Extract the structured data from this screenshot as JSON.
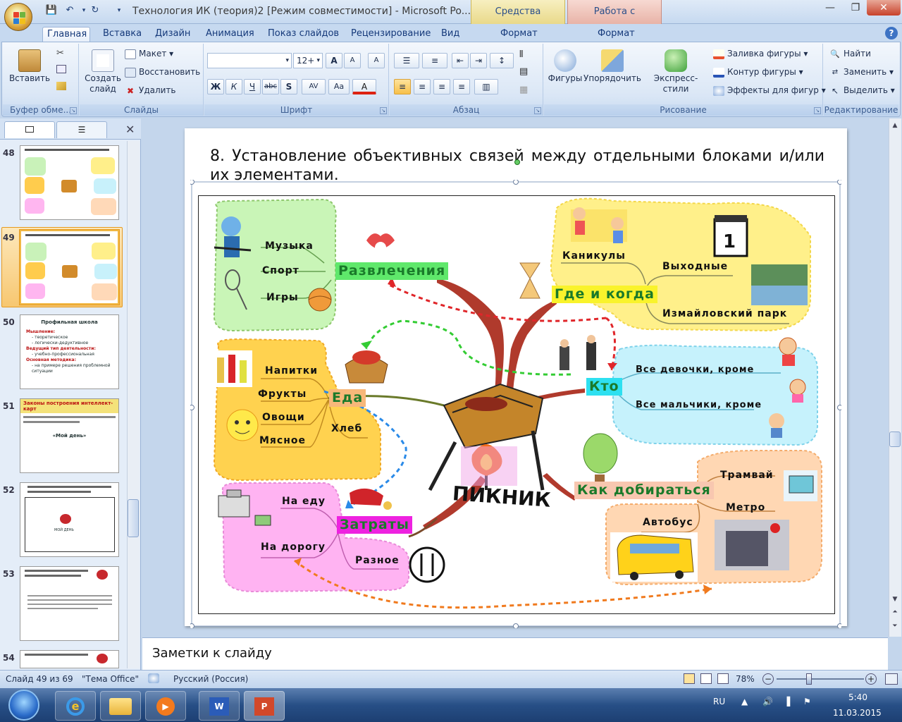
{
  "window": {
    "title": "Технология ИК (теория)2 [Режим совместимости]  -  Microsoft Po...",
    "context_tabs": [
      "Средства рисования",
      "Работа с рисунками"
    ]
  },
  "tabs": [
    "Главная",
    "Вставка",
    "Дизайн",
    "Анимация",
    "Показ слайдов",
    "Рецензирование",
    "Вид",
    "Формат",
    "Формат"
  ],
  "ribbon": {
    "clipboard": {
      "paste": "Вставить",
      "label": "Буфер обме..."
    },
    "slides": {
      "create_line1": "Создать",
      "create_line2": "слайд",
      "layout": "Макет",
      "reset": "Восстановить",
      "delete": "Удалить",
      "label": "Слайды"
    },
    "font": {
      "size": "12+",
      "bold": "Ж",
      "italic": "К",
      "underline": "Ч",
      "strike": "abc",
      "shadow": "S",
      "spacing": "AV",
      "case": "Aa",
      "color": "A",
      "grow": "A",
      "shrink": "A",
      "clear": "A",
      "label": "Шрифт"
    },
    "paragraph": {
      "label": "Абзац"
    },
    "drawing": {
      "shapes": "Фигуры",
      "arrange": "Упорядочить",
      "quick_styles": "Экспресс-стили",
      "fill": "Заливка фигуры",
      "outline": "Контур фигуры",
      "effects": "Эффекты для фигур",
      "label": "Рисование"
    },
    "editing": {
      "find": "Найти",
      "replace": "Заменить",
      "select": "Выделить",
      "label": "Редактирование"
    }
  },
  "thumbnails": [
    {
      "num": "48",
      "title": ""
    },
    {
      "num": "49",
      "title": ""
    },
    {
      "num": "50",
      "title": "Профильная школа",
      "lines": [
        "Мышление:",
        "- теоретическое",
        "- логически-дедуктивное",
        "Ведущий тип деятельности:",
        "- учебно-профессиональная",
        "Основная методика:",
        "- на примере решения проблемной ситуации"
      ]
    },
    {
      "num": "51",
      "title": "Законы построения интеллект-карт",
      "sub": "«Мой день»"
    },
    {
      "num": "52",
      "title": "",
      "sub": "МОЙ ДЕНЬ"
    },
    {
      "num": "53",
      "title": ""
    },
    {
      "num": "54",
      "title": ""
    }
  ],
  "slide": {
    "title": "8. Установление объективных связей между отдельными блоками и/или их элементами.",
    "center": "ПИКНИК",
    "branches": {
      "entertainment": {
        "title": "Развлечения",
        "items": [
          "Музыка",
          "Спорт",
          "Игры"
        ]
      },
      "where_when": {
        "title": "Где и когда",
        "items": [
          "Каникулы",
          "Выходные",
          "Измайловский парк"
        ]
      },
      "who": {
        "title": "Кто",
        "items": [
          "Все девочки, кроме",
          "Все мальчики, кроме"
        ]
      },
      "food": {
        "title": "Еда",
        "items": [
          "Напитки",
          "Фрукты",
          "Овощи",
          "Мясное",
          "Хлеб"
        ]
      },
      "costs": {
        "title": "Затраты",
        "items": [
          "На еду",
          "На дорогу",
          "Разное"
        ]
      },
      "transport": {
        "title": "Как добираться",
        "items": [
          "Трамвай",
          "Метро",
          "Автобус"
        ]
      }
    },
    "calendar_day": "1"
  },
  "notes": "Заметки к слайду",
  "status": {
    "slide": "Слайд 49 из 69",
    "theme": "\"Тема Office\"",
    "lang": "Русский (Россия)",
    "zoom": "78%"
  },
  "tray": {
    "lang": "RU",
    "time": "5:40",
    "date": "11.03.2015"
  },
  "colors": {
    "ribbon_bg": "#dbe7f6",
    "accent": "#f1b845"
  }
}
